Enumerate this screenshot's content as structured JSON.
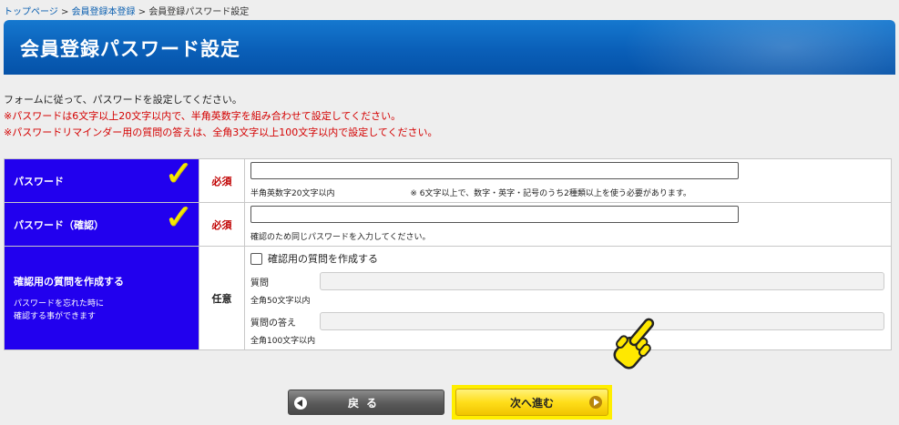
{
  "breadcrumb": {
    "home": "トップページ",
    "sep1": " > ",
    "member": "会員登録本登録",
    "sep2": " > ",
    "current": "会員登録パスワード設定"
  },
  "page_title": "会員登録パスワード設定",
  "intro": {
    "line1": "フォームに従って、パスワードを設定してください。",
    "line2": "※パスワードは6文字以上20文字以内で、半角英数字を組み合わせて設定してください。",
    "line3": "※パスワードリマインダー用の質問の答えは、全角3文字以上100文字以内で設定してください。"
  },
  "form": {
    "password": {
      "label": "パスワード",
      "required": "必須",
      "value": "",
      "note_left": "半角英数字20文字以内",
      "note_right": "※ 6文字以上で、数字・英字・記号のうち2種類以上を使う必要があります。"
    },
    "password_confirm": {
      "label": "パスワード（確認）",
      "required": "必須",
      "value": "",
      "note": "確認のため同じパスワードを入力してください。"
    },
    "question": {
      "label": "確認用の質問を作成する",
      "sub_line1": "パスワードを忘れた時に",
      "sub_line2": "確認する事ができます",
      "optional": "任意",
      "checkbox_label": "確認用の質問を作成する",
      "question_label": "質問",
      "question_value": "",
      "question_note": "全角50文字以内",
      "answer_label": "質問の答え",
      "answer_value": "",
      "answer_note": "全角100文字以内"
    }
  },
  "buttons": {
    "back": "戻る",
    "next": "次へ進む"
  },
  "colors": {
    "title_bar": "#0a5fb8",
    "label_cell": "#2200ee",
    "required": "#c00000",
    "warning": "#d40000",
    "highlight": "#ffee00"
  },
  "icons": {
    "checkmark": "yellow-checkmark-icon",
    "pointer": "pointing-hand-icon"
  }
}
